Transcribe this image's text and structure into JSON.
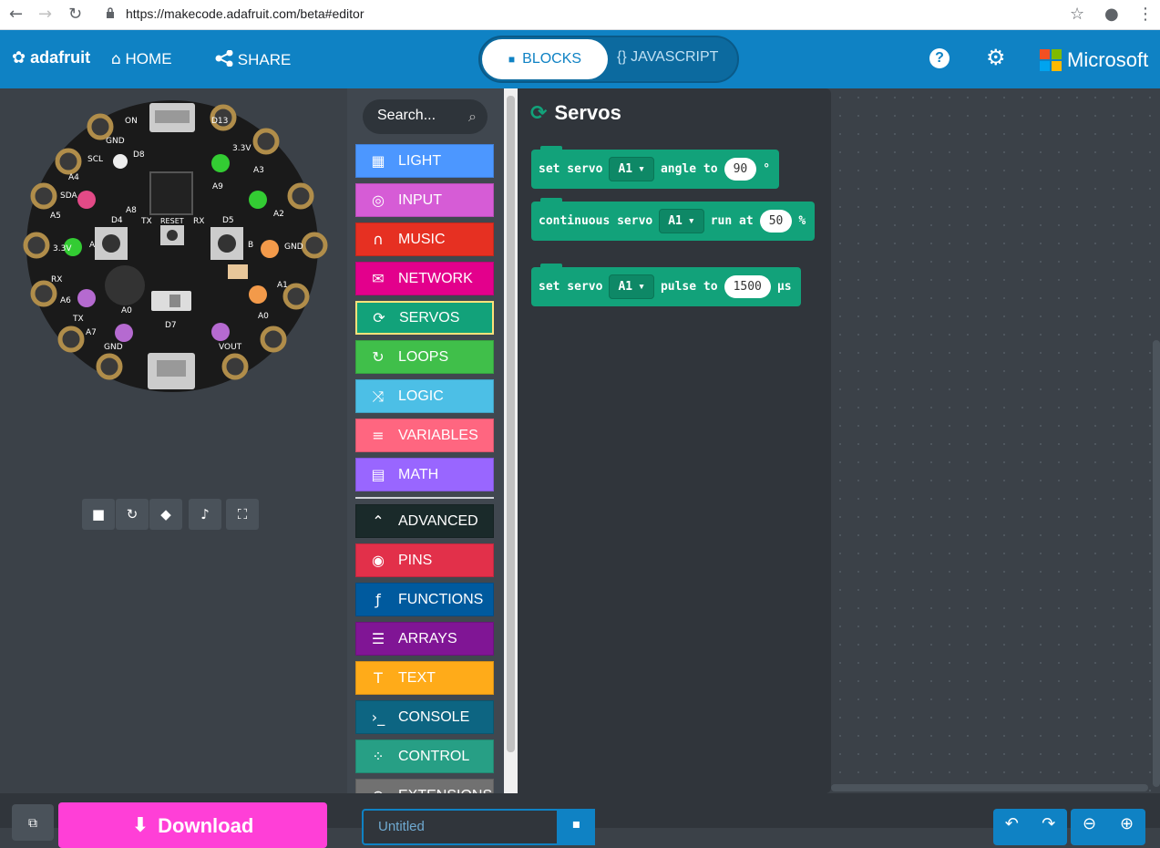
{
  "browser": {
    "url": "https://makecode.adafruit.com/beta#editor"
  },
  "header": {
    "logo": "adafruit",
    "home": "HOME",
    "share": "SHARE",
    "blocks": "BLOCKS",
    "javascript": "{} JAVASCRIPT",
    "brand": "Microsoft"
  },
  "toolbox": {
    "search_placeholder": "Search...",
    "categories": [
      {
        "label": "LIGHT",
        "color": "#4c97ff",
        "icon": "grid-icon"
      },
      {
        "label": "INPUT",
        "color": "#d65cd6",
        "icon": "target-icon"
      },
      {
        "label": "MUSIC",
        "color": "#e63022",
        "icon": "headphones-icon"
      },
      {
        "label": "NETWORK",
        "color": "#e3008c",
        "icon": "chat-icon"
      },
      {
        "label": "SERVOS",
        "color": "#12a27a",
        "icon": "refresh-icon"
      },
      {
        "label": "LOOPS",
        "color": "#40bf4a",
        "icon": "loop-icon"
      },
      {
        "label": "LOGIC",
        "color": "#4cbfe6",
        "icon": "shuffle-icon"
      },
      {
        "label": "VARIABLES",
        "color": "#ff6680",
        "icon": "list-icon"
      },
      {
        "label": "MATH",
        "color": "#9966ff",
        "icon": "calculator-icon"
      }
    ],
    "advanced": [
      {
        "label": "ADVANCED",
        "color": "#1a2a2a",
        "icon": "chevron-up-icon"
      },
      {
        "label": "PINS",
        "color": "#e2304a",
        "icon": "pin-icon"
      },
      {
        "label": "FUNCTIONS",
        "color": "#005a9e",
        "icon": "function-icon"
      },
      {
        "label": "ARRAYS",
        "color": "#801595",
        "icon": "array-icon"
      },
      {
        "label": "TEXT",
        "color": "#ffab19",
        "icon": "text-icon"
      },
      {
        "label": "CONSOLE",
        "color": "#0d6582",
        "icon": "console-icon"
      },
      {
        "label": "CONTROL",
        "color": "#279f85",
        "icon": "dots-icon"
      },
      {
        "label": "EXTENSIONS",
        "color": "#717171",
        "icon": "plus-icon"
      }
    ]
  },
  "flyout": {
    "title": "Servos",
    "blocks": [
      {
        "prefix": "set servo",
        "pin": "A1",
        "mid": "angle to",
        "value": "90",
        "unit": "°"
      },
      {
        "prefix": "continuous servo",
        "pin": "A1",
        "mid": "run at",
        "value": "50",
        "unit": "%"
      },
      {
        "prefix": "set servo",
        "pin": "A1",
        "mid": "pulse to",
        "value": "1500",
        "unit": "μs"
      }
    ]
  },
  "simulator": {
    "labels": {
      "d13": "D13",
      "d8": "D8",
      "gnd": "GND",
      "scl": "SCL",
      "a4": "A4",
      "sda": "SDA",
      "a5": "A5",
      "v33": "3.3V",
      "a2": "A2",
      "a3": "A3",
      "a9": "A9",
      "a8": "A8",
      "d4": "D4",
      "d5": "D5",
      "tx": "TX",
      "rx": "RX",
      "reset": "RESET",
      "a6": "A6",
      "a7": "A7",
      "a1": "A1",
      "a0": "A0",
      "d7": "D7",
      "vout": "VOUT",
      "on": "ON",
      "a": "A",
      "b": "B"
    }
  },
  "bottom": {
    "download": "Download",
    "project_name": "Untitled"
  },
  "colors": {
    "header": "#0f82c4",
    "download": "#ff3fd7",
    "servo_block": "#12a27a"
  }
}
